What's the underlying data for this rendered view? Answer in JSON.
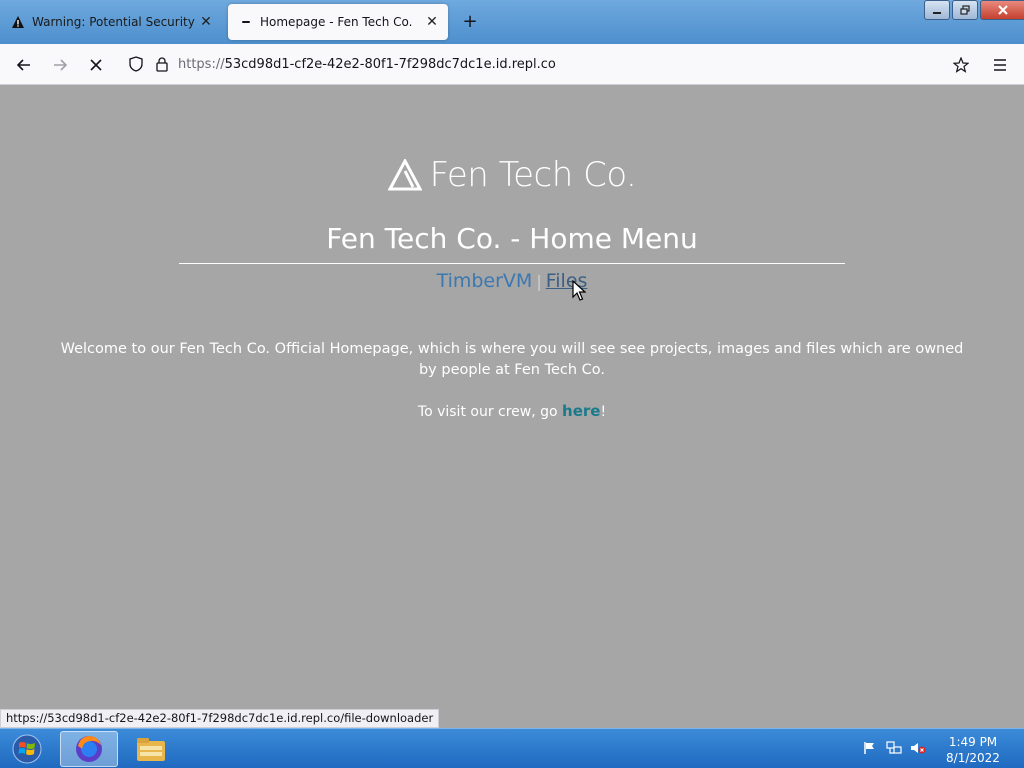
{
  "browser": {
    "tabs": [
      {
        "title": "Warning: Potential Security Risk",
        "active": false
      },
      {
        "title": "Homepage - Fen Tech Co.",
        "active": true
      }
    ],
    "new_tab_symbol": "+",
    "url": {
      "scheme": "https://",
      "host": "53cd98d1-cf2e-42e2-80f1-7f298dc7dc1e.id.repl.co"
    },
    "status_url": "https://53cd98d1-cf2e-42e2-80f1-7f298dc7dc1e.id.repl.co/file-downloader"
  },
  "page": {
    "logo_text": "Fen Tech Co.",
    "title": "Fen Tech Co. - Home Menu",
    "menu": {
      "timber": "TimberVM",
      "separator": "|",
      "files": "Files"
    },
    "welcome": "Welcome to our Fen Tech Co. Official Homepage, which is where you will see see projects, images and files which are owned by people at Fen Tech Co.",
    "crew_prefix": "To visit our crew, go ",
    "crew_link": "here",
    "crew_suffix": "!"
  },
  "taskbar": {
    "time": "1:49 PM",
    "date": "8/1/2022"
  },
  "colors": {
    "page_bg": "#a6a6a6",
    "link_timber": "#3c78b0",
    "link_files": "#3c5f84",
    "link_here": "#1a7a8c"
  }
}
